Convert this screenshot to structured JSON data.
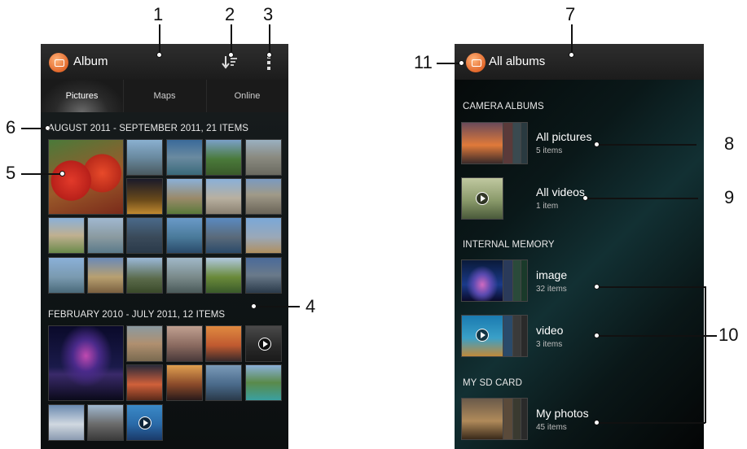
{
  "left_screen": {
    "title": "Album",
    "tabs": [
      "Pictures",
      "Maps",
      "Online"
    ],
    "group1": {
      "header": "AUGUST 2011 - SEPTEMBER 2011, 21 ITEMS"
    },
    "group2": {
      "header": "FEBRUARY 2010 - JULY 2011, 12 ITEMS"
    }
  },
  "right_screen": {
    "title": "All albums",
    "sections": [
      "CAMERA ALBUMS",
      "INTERNAL MEMORY",
      "MY SD CARD"
    ],
    "albums": [
      {
        "name": "All pictures",
        "count": "5 items"
      },
      {
        "name": "All videos",
        "count": "1 item"
      },
      {
        "name": "image",
        "count": "32 items"
      },
      {
        "name": "video",
        "count": "3 items"
      },
      {
        "name": "My photos",
        "count": "45 items"
      }
    ]
  },
  "callouts": [
    "1",
    "2",
    "3",
    "4",
    "5",
    "6",
    "7",
    "8",
    "9",
    "10",
    "11"
  ]
}
